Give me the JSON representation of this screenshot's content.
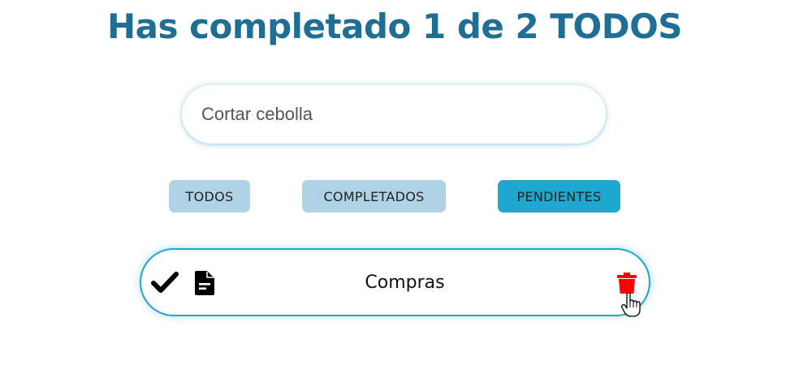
{
  "header": {
    "title": "Has completado 1 de 2 TODOS"
  },
  "new_todo": {
    "value": "Cortar cebolla",
    "placeholder": ""
  },
  "filters": {
    "todos_label": "TODOS",
    "completados_label": "COMPLETADOS",
    "pendientes_label": "PENDIENTES",
    "active": "PENDIENTES"
  },
  "todos": [
    {
      "text": "Compras",
      "completed": false,
      "icons": [
        "check-icon",
        "document-icon",
        "trash-icon"
      ]
    }
  ],
  "colors": {
    "title": "#1f6f94",
    "filter_button": "#afd3e4",
    "filter_button_active": "#1ea7cf",
    "item_border": "#1ea7cf",
    "trash": "#ff0000"
  }
}
